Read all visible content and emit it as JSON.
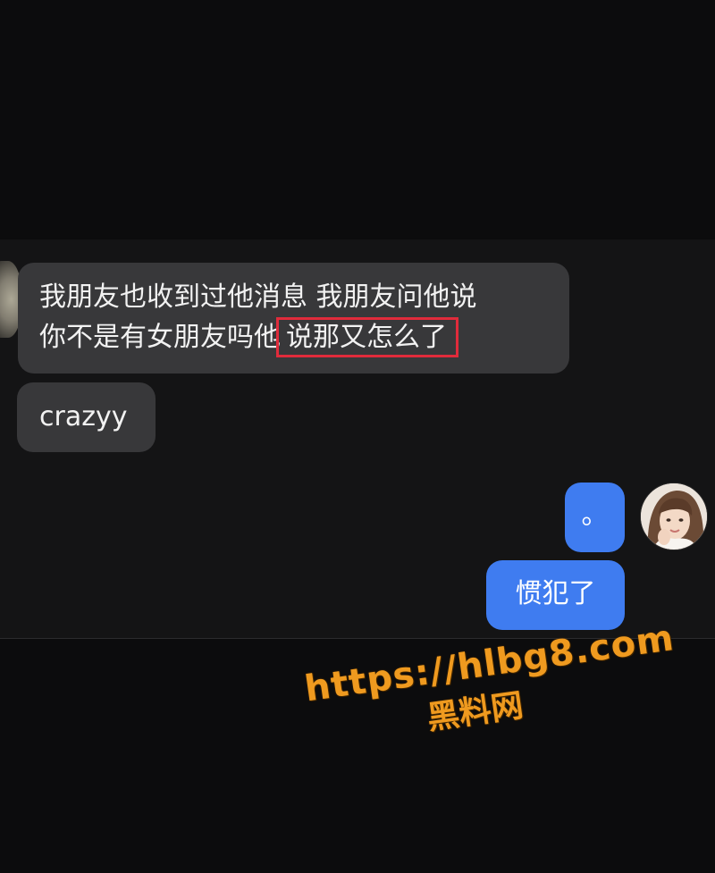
{
  "chat": {
    "messages": [
      {
        "direction": "incoming",
        "line1": "我朋友也收到过他消息 我朋友问他说",
        "line2_plain": "你不是有女朋友吗他",
        "line2_highlight": "说那又怎么了"
      },
      {
        "direction": "incoming",
        "text": "crazyy"
      },
      {
        "direction": "outgoing",
        "text": "。"
      },
      {
        "direction": "outgoing",
        "text": "惯犯了"
      }
    ],
    "highlight_color": "#e02b3b",
    "incoming_bubble_color": "#38383a",
    "outgoing_bubble_color": "#3f7cf0"
  },
  "watermark": {
    "url": "https://hlbg8.com",
    "site_name": "黑料网",
    "color": "#ef9a1f"
  }
}
